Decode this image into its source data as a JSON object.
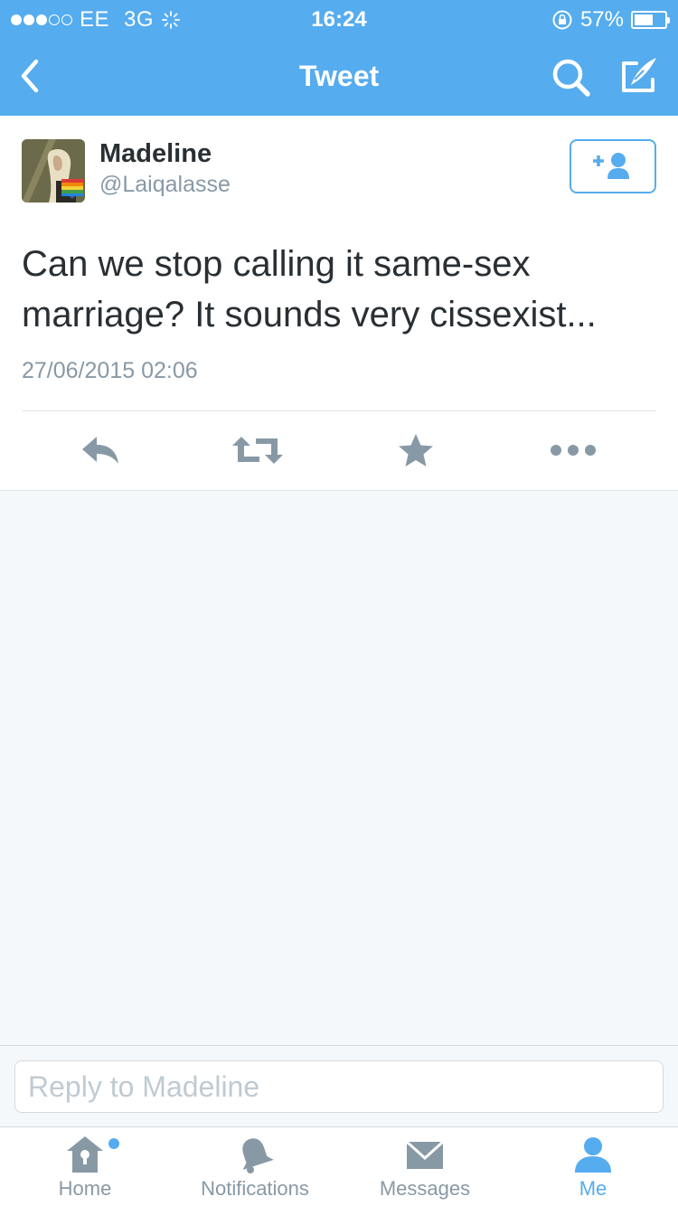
{
  "status_bar": {
    "carrier": "EE",
    "network": "3G",
    "time": "16:24",
    "battery": "57%",
    "battery_level": 0.57,
    "signal_bars_filled": 3,
    "signal_bars_total": 5
  },
  "nav": {
    "title": "Tweet",
    "icons": [
      "back-chevron-icon",
      "search-icon",
      "compose-icon"
    ]
  },
  "tweet": {
    "name": "Madeline",
    "handle": "@Laiqalasse",
    "text": "Can we stop calling it same-sex marriage? It sounds very cissexist...",
    "timestamp": "27/06/2015 02:06",
    "follow_icon": "add-user-icon",
    "actions": [
      "reply-icon",
      "retweet-icon",
      "favorite-icon",
      "more-icon"
    ]
  },
  "reply": {
    "placeholder": "Reply to Madeline",
    "value": ""
  },
  "tabs": [
    {
      "label": "Home",
      "icon": "home-icon",
      "active": false,
      "has_notification": true
    },
    {
      "label": "Notifications",
      "icon": "bell-icon",
      "active": false,
      "has_notification": false
    },
    {
      "label": "Messages",
      "icon": "envelope-icon",
      "active": false,
      "has_notification": false
    },
    {
      "label": "Me",
      "icon": "person-icon",
      "active": true,
      "has_notification": false
    }
  ],
  "colors": {
    "brand": "#55acee",
    "text_primary": "#292f33",
    "text_secondary": "#8899a6",
    "icon_gray": "#8899a6",
    "background": "#f5f8fa"
  }
}
